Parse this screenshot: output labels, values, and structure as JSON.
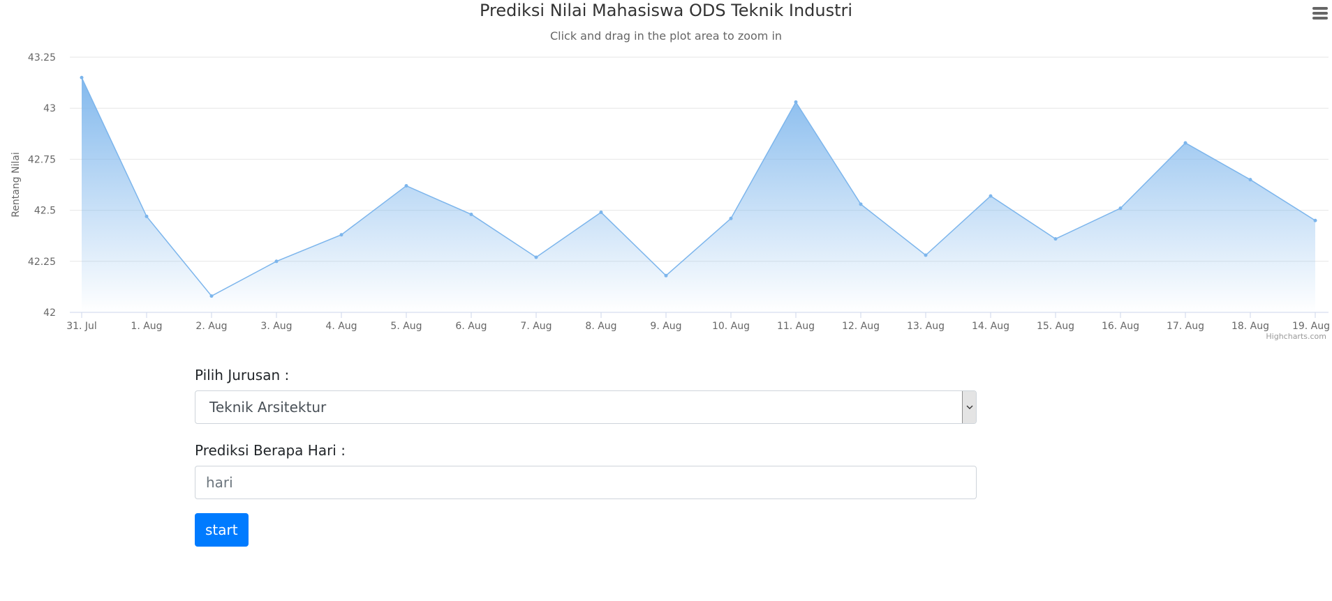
{
  "chart_data": {
    "type": "area",
    "title": "Prediksi Nilai Mahasiswa ODS Teknik Industri",
    "subtitle": "Click and drag in the plot area to zoom in",
    "ylabel": "Rentang Nilai",
    "xlabel": "",
    "x": [
      "31. Jul",
      "1. Aug",
      "2. Aug",
      "3. Aug",
      "4. Aug",
      "5. Aug",
      "6. Aug",
      "7. Aug",
      "8. Aug",
      "9. Aug",
      "10. Aug",
      "11. Aug",
      "12. Aug",
      "13. Aug",
      "14. Aug",
      "15. Aug",
      "16. Aug",
      "17. Aug",
      "18. Aug",
      "19. Aug"
    ],
    "values": [
      43.15,
      42.47,
      42.08,
      42.25,
      42.38,
      42.62,
      42.48,
      42.27,
      42.49,
      42.18,
      42.46,
      43.03,
      42.53,
      42.28,
      42.57,
      42.36,
      42.51,
      42.83,
      42.65,
      42.45
    ],
    "ylim": [
      42,
      43.25
    ],
    "yticks": [
      "42",
      "42.25",
      "42.5",
      "42.75",
      "43",
      "43.25"
    ],
    "grid": true,
    "legend": "none",
    "colors": {
      "line": "#7cb5ec",
      "fill_top": "#7cb5ec",
      "grid": "#e6e6e6",
      "axis_text": "#666666"
    }
  },
  "credits": "Highcharts.com",
  "menu": {
    "icon": "hamburger-menu-icon"
  },
  "form": {
    "jurusan_label": "Pilih Jurusan :",
    "jurusan_value": "Teknik Arsitektur",
    "hari_label": "Prediksi Berapa Hari :",
    "hari_placeholder": "hari",
    "start_label": "start",
    "start_color": "#007bff"
  }
}
